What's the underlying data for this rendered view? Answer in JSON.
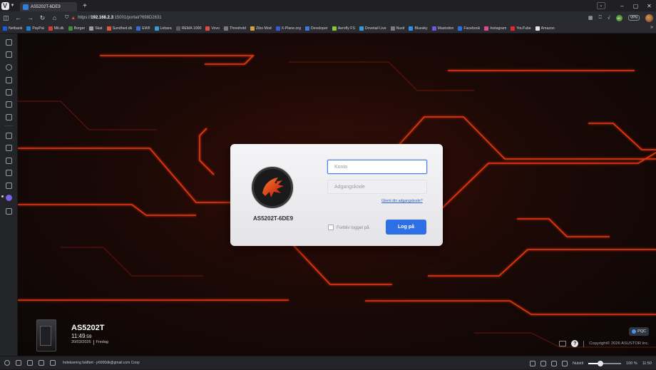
{
  "browser": {
    "tab_title": "AS5202T-6DE9",
    "new_tab_symbol": "+",
    "url_prefix": "https://",
    "url_host": "192.168.2.3",
    "url_rest": ":15001/portal/?698D2631",
    "window_controls": [
      "–",
      "▢",
      "✕"
    ],
    "toolbar_labels": {
      "vpn": "VPN",
      "ext_badge": "60"
    }
  },
  "bookmarks": {
    "items": [
      {
        "label": "Netbank",
        "color": "#1e5bd8"
      },
      {
        "label": "PayPal",
        "color": "#1d7fd8"
      },
      {
        "label": "Mit.dk",
        "color": "#d83a3a"
      },
      {
        "label": "Borger",
        "color": "#3a8f3a"
      },
      {
        "label": "Skat",
        "color": "#9a9aa0"
      },
      {
        "label": "Sundhed.dk",
        "color": "#e05a3a"
      },
      {
        "label": "EWII",
        "color": "#3a6ad8"
      },
      {
        "label": "Lebara",
        "color": "#3a9ad8"
      },
      {
        "label": "REMA 1000",
        "color": "#5a5a60"
      },
      {
        "label": "Vovo",
        "color": "#e24a3b"
      },
      {
        "label": "Threshold",
        "color": "#7a7a80"
      },
      {
        "label": "Zibo Mod",
        "color": "#d8a23a"
      },
      {
        "label": "X-Plane.org",
        "color": "#3a5ad8"
      },
      {
        "label": "Developer",
        "color": "#3a7ad8"
      },
      {
        "label": "Aerofly FS",
        "color": "#8ac83a"
      },
      {
        "label": "Dovetail Live",
        "color": "#3a9ad8"
      },
      {
        "label": "Nuxit",
        "color": "#7a7a80"
      },
      {
        "label": "Bluesky",
        "color": "#2f8ff0"
      },
      {
        "label": "Mastodon",
        "color": "#6a5ae0"
      },
      {
        "label": "Facebook",
        "color": "#2f6fe6"
      },
      {
        "label": "Instagram",
        "color": "#e04a8a"
      },
      {
        "label": "YouTube",
        "color": "#e02a2a"
      },
      {
        "label": "Amazon",
        "color": "#e6e6ea"
      }
    ],
    "more_symbol": "»"
  },
  "login": {
    "device_name": "AS5202T-6DE9",
    "account_placeholder": "Konto",
    "password_placeholder": "Adgangskode",
    "forgot_password": "Glemt din adgangskode?",
    "remember_label": "Forbliv logget på",
    "login_button": "Log på"
  },
  "device": {
    "model": "AS5202T",
    "time_hm": "11:49",
    "time_s": ":59",
    "date": "20/03/2026",
    "weekday": "Fredag"
  },
  "footer": {
    "pqc_label": "PQC",
    "help_symbol": "?",
    "copyright": "Copyright© 2026 ASUSTOR Inc."
  },
  "statusbar": {
    "message": "Indeksering fuldført - jr6000dk@gmail.com Coop",
    "reset_label": "Nulstil",
    "zoom": "100 %",
    "zoom_fraction": 1.0,
    "clock": "11:50"
  }
}
